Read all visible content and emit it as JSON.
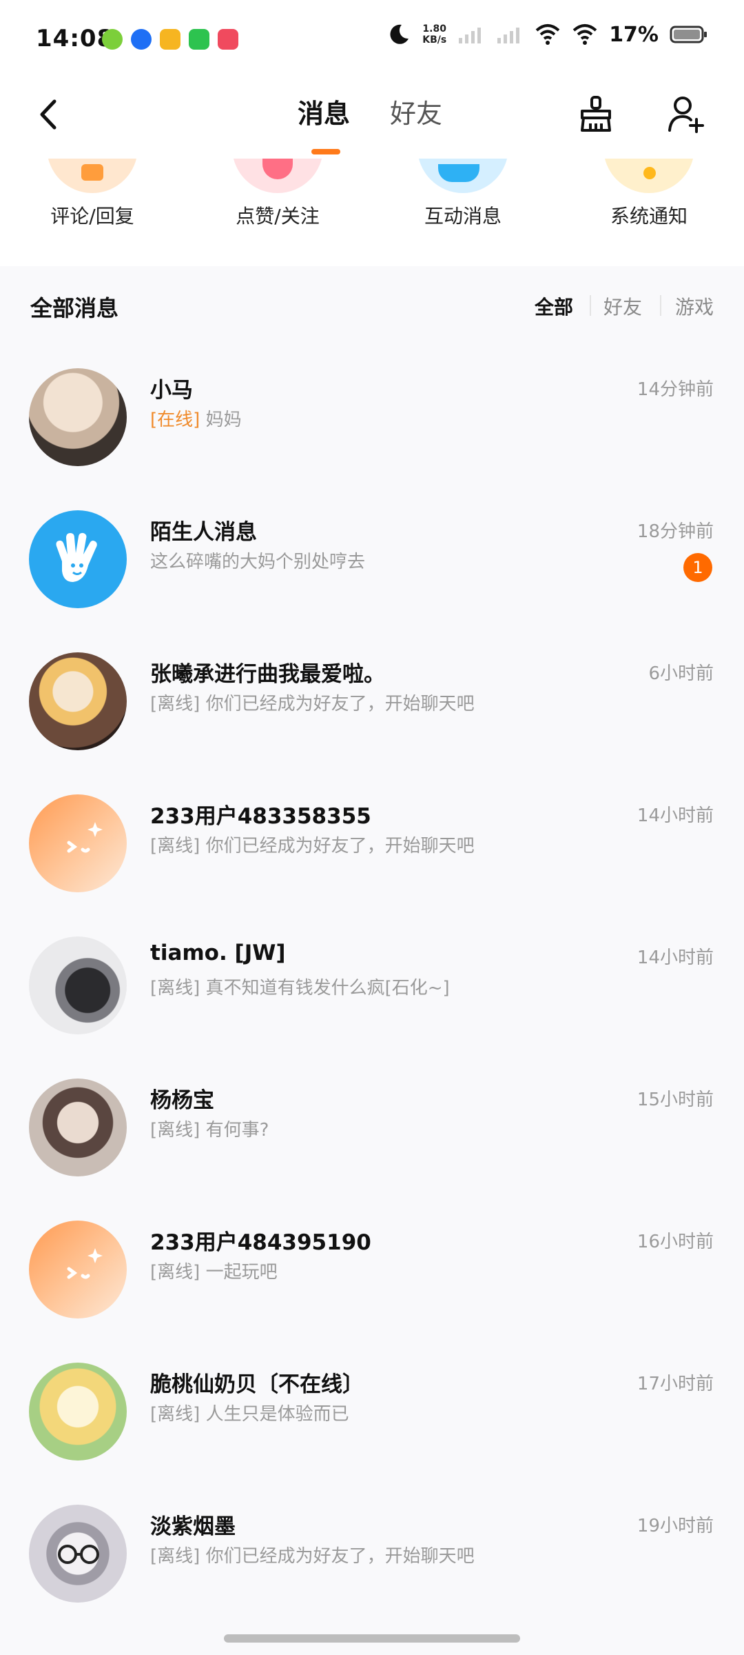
{
  "status_bar": {
    "time": "14:08",
    "net_speed_value": "1.80",
    "net_speed_unit": "KB/s",
    "battery": "17%",
    "apps": [
      "app-icon-green",
      "app-icon-blue-k",
      "app-icon-yellow",
      "wechat-icon",
      "video-icon-red"
    ]
  },
  "nav": {
    "tabs": [
      {
        "label": "消息",
        "active": true
      },
      {
        "label": "好友",
        "active": false
      }
    ]
  },
  "quick": [
    {
      "label": "评论/回复",
      "color": "#ffb86b",
      "icon": "comment-icon"
    },
    {
      "label": "点赞/关注",
      "color": "#ff7b8e",
      "icon": "like-icon"
    },
    {
      "label": "互动消息",
      "color": "#39b8f5",
      "icon": "interaction-icon"
    },
    {
      "label": "系统通知",
      "color": "#ffcf4a",
      "icon": "bell-icon"
    }
  ],
  "section": {
    "title": "全部消息",
    "filters": [
      "全部",
      "好友",
      "游戏"
    ],
    "active_filter": "全部"
  },
  "messages": [
    {
      "name": "小马",
      "status": "[在线]",
      "online": true,
      "text": "妈妈",
      "time": "14分钟前",
      "badge": null,
      "avatar_colors": [
        "#e8d8c8",
        "#7a6a5e"
      ]
    },
    {
      "name": "陌生人消息",
      "status": "",
      "online": false,
      "text": "这么碎嘴的大妈个别处哼去",
      "time": "18分钟前",
      "badge": "1",
      "avatar_colors": [
        "#29a9f0",
        "#ffffff"
      ]
    },
    {
      "name": "张曦承进行曲我最爱啦。",
      "status": "[离线]",
      "online": false,
      "text": "你们已经成为好友了，开始聊天吧",
      "time": "6小时前",
      "badge": null,
      "avatar_colors": [
        "#5c3a2e",
        "#f4c26b"
      ]
    },
    {
      "name": "233用户483358355",
      "status": "[离线]",
      "online": false,
      "text": "你们已经成为好友了，开始聊天吧",
      "time": "14小时前",
      "badge": null,
      "avatar_colors": [
        "#ff9f5a",
        "#fde6d2"
      ]
    },
    {
      "name": "tiamo. [JW]",
      "status": "[离线]",
      "online": false,
      "text": "真不知道有钱发什么疯[石化~]",
      "time": "14小时前",
      "badge": null,
      "avatar_colors": [
        "#eeeeee",
        "#333333"
      ]
    },
    {
      "name": "杨杨宝",
      "status": "[离线]",
      "online": false,
      "text": "有何事?",
      "time": "15小时前",
      "badge": null,
      "avatar_colors": [
        "#d8cfc7",
        "#3a2c28"
      ]
    },
    {
      "name": "233用户484395190",
      "status": "[离线]",
      "online": false,
      "text": "一起玩吧",
      "time": "16小时前",
      "badge": null,
      "avatar_colors": [
        "#ff9f5a",
        "#fde6d2"
      ]
    },
    {
      "name": "脆桃仙奶贝〔不在线〕",
      "status": "[离线]",
      "online": false,
      "text": "人生只是体验而已",
      "time": "17小时前",
      "badge": null,
      "avatar_colors": [
        "#f5e6a8",
        "#9cc67a"
      ]
    },
    {
      "name": "淡紫烟墨",
      "status": "[离线]",
      "online": false,
      "text": "你们已经成为好友了，开始聊天吧",
      "time": "19小时前",
      "badge": null,
      "avatar_colors": [
        "#cfcfd4",
        "#555555"
      ]
    }
  ]
}
